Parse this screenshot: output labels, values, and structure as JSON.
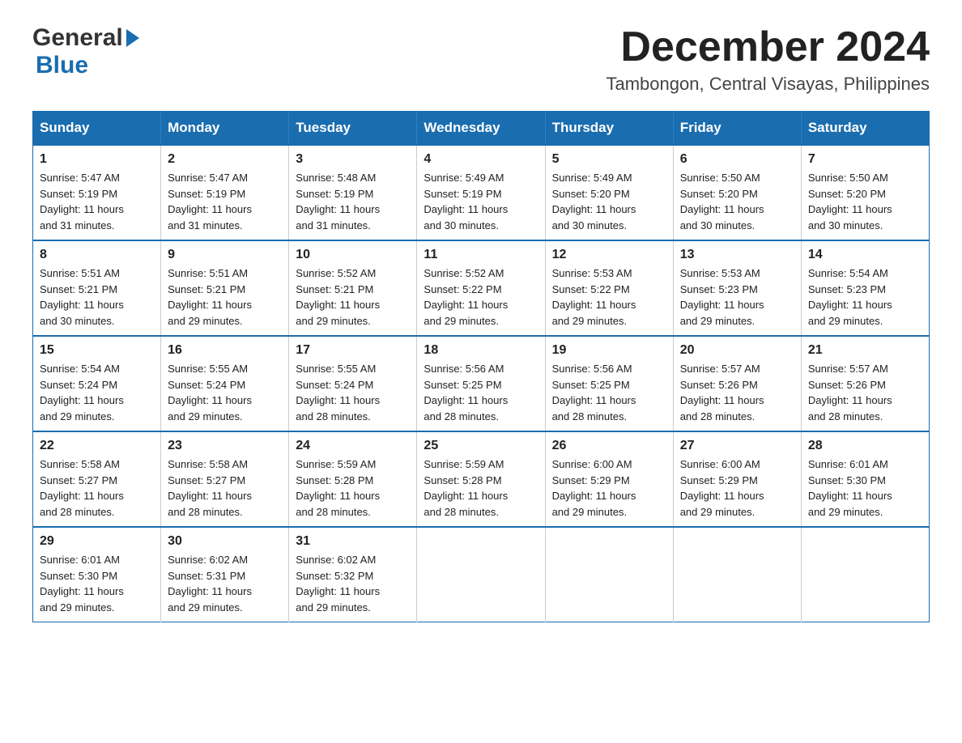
{
  "logo": {
    "general": "General",
    "blue": "Blue",
    "triangle": "▶"
  },
  "header": {
    "month": "December 2024",
    "location": "Tambongon, Central Visayas, Philippines"
  },
  "weekdays": [
    "Sunday",
    "Monday",
    "Tuesday",
    "Wednesday",
    "Thursday",
    "Friday",
    "Saturday"
  ],
  "weeks": [
    [
      {
        "day": "1",
        "sunrise": "5:47 AM",
        "sunset": "5:19 PM",
        "daylight": "11 hours and 31 minutes."
      },
      {
        "day": "2",
        "sunrise": "5:47 AM",
        "sunset": "5:19 PM",
        "daylight": "11 hours and 31 minutes."
      },
      {
        "day": "3",
        "sunrise": "5:48 AM",
        "sunset": "5:19 PM",
        "daylight": "11 hours and 31 minutes."
      },
      {
        "day": "4",
        "sunrise": "5:49 AM",
        "sunset": "5:19 PM",
        "daylight": "11 hours and 30 minutes."
      },
      {
        "day": "5",
        "sunrise": "5:49 AM",
        "sunset": "5:20 PM",
        "daylight": "11 hours and 30 minutes."
      },
      {
        "day": "6",
        "sunrise": "5:50 AM",
        "sunset": "5:20 PM",
        "daylight": "11 hours and 30 minutes."
      },
      {
        "day": "7",
        "sunrise": "5:50 AM",
        "sunset": "5:20 PM",
        "daylight": "11 hours and 30 minutes."
      }
    ],
    [
      {
        "day": "8",
        "sunrise": "5:51 AM",
        "sunset": "5:21 PM",
        "daylight": "11 hours and 30 minutes."
      },
      {
        "day": "9",
        "sunrise": "5:51 AM",
        "sunset": "5:21 PM",
        "daylight": "11 hours and 29 minutes."
      },
      {
        "day": "10",
        "sunrise": "5:52 AM",
        "sunset": "5:21 PM",
        "daylight": "11 hours and 29 minutes."
      },
      {
        "day": "11",
        "sunrise": "5:52 AM",
        "sunset": "5:22 PM",
        "daylight": "11 hours and 29 minutes."
      },
      {
        "day": "12",
        "sunrise": "5:53 AM",
        "sunset": "5:22 PM",
        "daylight": "11 hours and 29 minutes."
      },
      {
        "day": "13",
        "sunrise": "5:53 AM",
        "sunset": "5:23 PM",
        "daylight": "11 hours and 29 minutes."
      },
      {
        "day": "14",
        "sunrise": "5:54 AM",
        "sunset": "5:23 PM",
        "daylight": "11 hours and 29 minutes."
      }
    ],
    [
      {
        "day": "15",
        "sunrise": "5:54 AM",
        "sunset": "5:24 PM",
        "daylight": "11 hours and 29 minutes."
      },
      {
        "day": "16",
        "sunrise": "5:55 AM",
        "sunset": "5:24 PM",
        "daylight": "11 hours and 29 minutes."
      },
      {
        "day": "17",
        "sunrise": "5:55 AM",
        "sunset": "5:24 PM",
        "daylight": "11 hours and 28 minutes."
      },
      {
        "day": "18",
        "sunrise": "5:56 AM",
        "sunset": "5:25 PM",
        "daylight": "11 hours and 28 minutes."
      },
      {
        "day": "19",
        "sunrise": "5:56 AM",
        "sunset": "5:25 PM",
        "daylight": "11 hours and 28 minutes."
      },
      {
        "day": "20",
        "sunrise": "5:57 AM",
        "sunset": "5:26 PM",
        "daylight": "11 hours and 28 minutes."
      },
      {
        "day": "21",
        "sunrise": "5:57 AM",
        "sunset": "5:26 PM",
        "daylight": "11 hours and 28 minutes."
      }
    ],
    [
      {
        "day": "22",
        "sunrise": "5:58 AM",
        "sunset": "5:27 PM",
        "daylight": "11 hours and 28 minutes."
      },
      {
        "day": "23",
        "sunrise": "5:58 AM",
        "sunset": "5:27 PM",
        "daylight": "11 hours and 28 minutes."
      },
      {
        "day": "24",
        "sunrise": "5:59 AM",
        "sunset": "5:28 PM",
        "daylight": "11 hours and 28 minutes."
      },
      {
        "day": "25",
        "sunrise": "5:59 AM",
        "sunset": "5:28 PM",
        "daylight": "11 hours and 28 minutes."
      },
      {
        "day": "26",
        "sunrise": "6:00 AM",
        "sunset": "5:29 PM",
        "daylight": "11 hours and 29 minutes."
      },
      {
        "day": "27",
        "sunrise": "6:00 AM",
        "sunset": "5:29 PM",
        "daylight": "11 hours and 29 minutes."
      },
      {
        "day": "28",
        "sunrise": "6:01 AM",
        "sunset": "5:30 PM",
        "daylight": "11 hours and 29 minutes."
      }
    ],
    [
      {
        "day": "29",
        "sunrise": "6:01 AM",
        "sunset": "5:30 PM",
        "daylight": "11 hours and 29 minutes."
      },
      {
        "day": "30",
        "sunrise": "6:02 AM",
        "sunset": "5:31 PM",
        "daylight": "11 hours and 29 minutes."
      },
      {
        "day": "31",
        "sunrise": "6:02 AM",
        "sunset": "5:32 PM",
        "daylight": "11 hours and 29 minutes."
      },
      null,
      null,
      null,
      null
    ]
  ],
  "labels": {
    "sunrise": "Sunrise:",
    "sunset": "Sunset:",
    "daylight": "Daylight:"
  }
}
